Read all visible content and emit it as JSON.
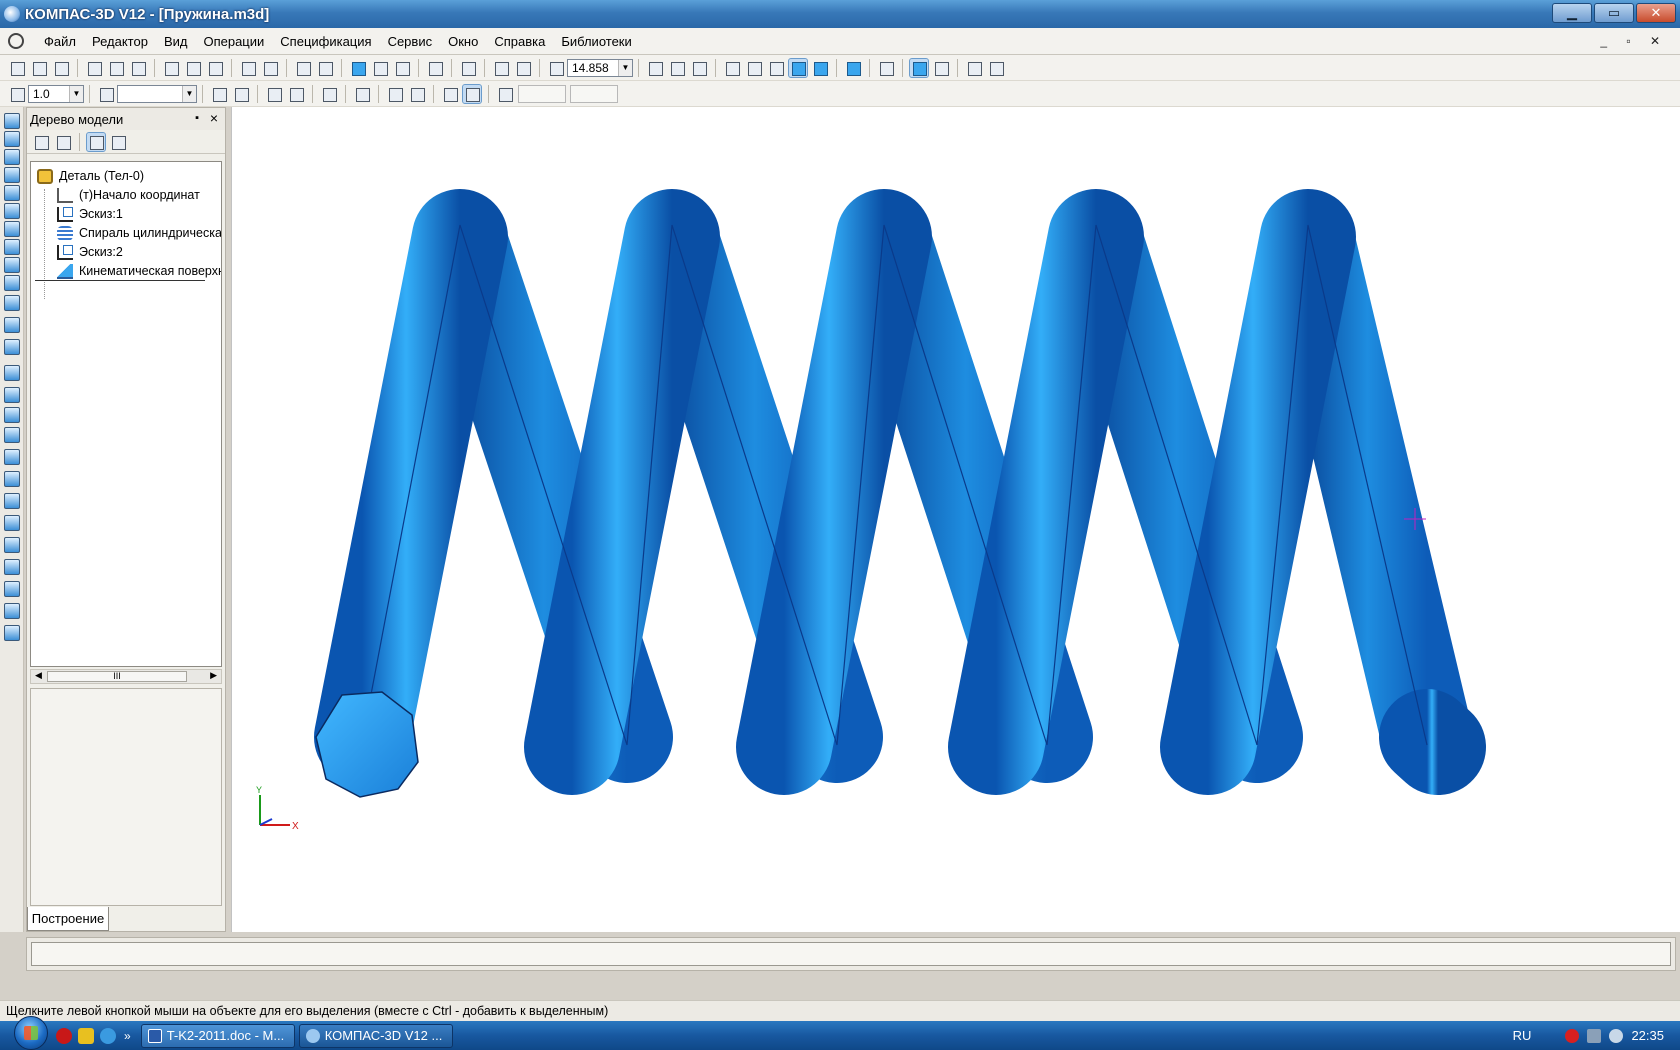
{
  "window": {
    "title": "КОМПАС-3D V12 - [Пружина.m3d]",
    "buttons": {
      "minimize": "▁",
      "maximize": "▭",
      "close": "✕"
    }
  },
  "menu": {
    "items": [
      "Файл",
      "Редактор",
      "Вид",
      "Операции",
      "Спецификация",
      "Сервис",
      "Окно",
      "Справка",
      "Библиотеки"
    ],
    "mdi_controls": "_ ▫ ✕"
  },
  "toolbar": {
    "zoom_value": "14.858",
    "step_value": "1.0"
  },
  "model_tree": {
    "title": "Дерево модели",
    "nodes": [
      {
        "label": "Деталь (Тел-0)",
        "icon": "part-icon"
      },
      {
        "label": "(т)Начало координат",
        "icon": "origin-icon"
      },
      {
        "label": "Эскиз:1",
        "icon": "sketch-icon"
      },
      {
        "label": "Спираль цилиндрическая",
        "icon": "spiral-icon"
      },
      {
        "label": "Эскиз:2",
        "icon": "sketch-icon"
      },
      {
        "label": "Кинематическая поверхность",
        "icon": "kinematic-icon"
      }
    ],
    "scroll_thumb": "III",
    "tab_label": "Построение"
  },
  "viewport": {
    "axis_x": "X",
    "axis_y": "Y",
    "spring_color": "#1a8de6"
  },
  "status": {
    "message": "Щелкните левой кнопкой мыши на объекте для его выделения (вместе с Ctrl - добавить к выделенным)"
  },
  "taskbar": {
    "quick_more": "»",
    "buttons": [
      "T-K2-2011.doc - M...",
      "КОМПАС-3D V12 ..."
    ],
    "language": "RU",
    "clock": "22:35"
  }
}
